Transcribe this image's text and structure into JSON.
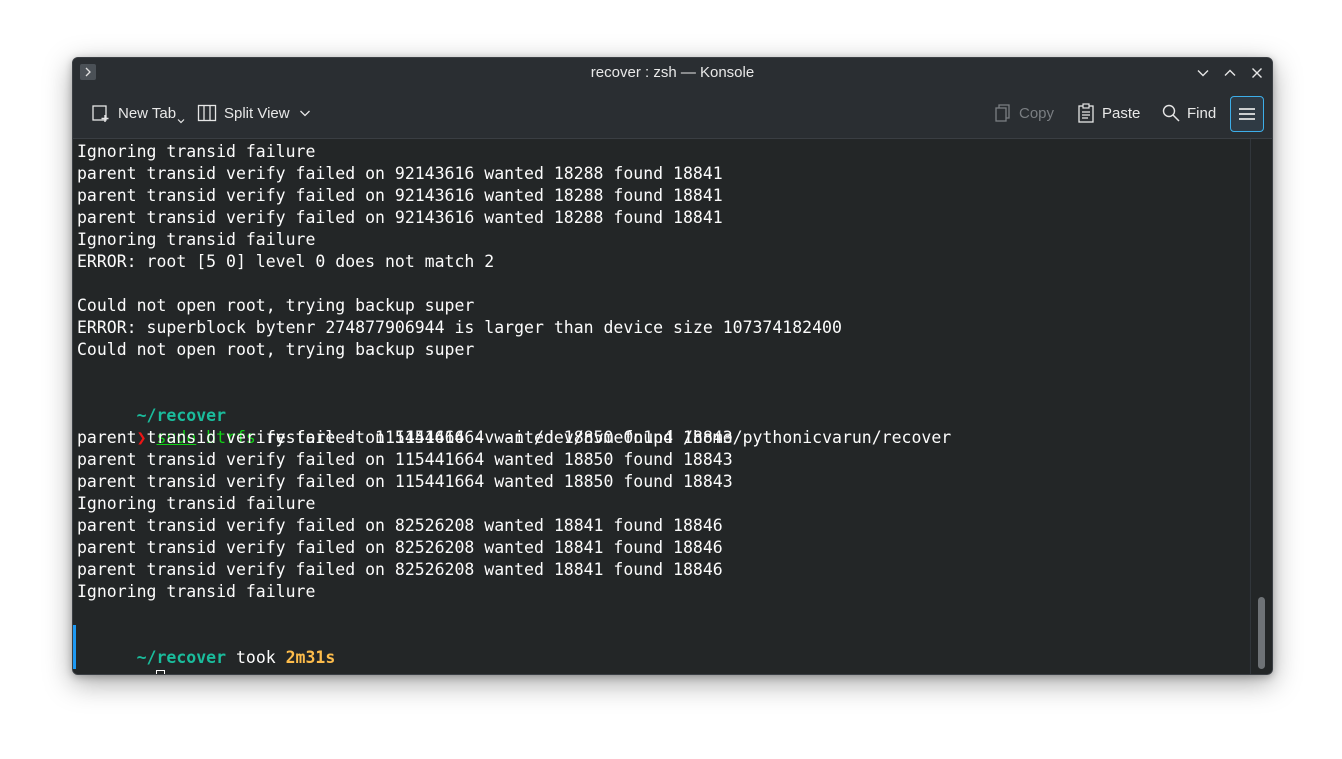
{
  "window": {
    "title": "recover : zsh — Konsole"
  },
  "toolbar": {
    "new_tab_label": "New Tab",
    "split_view_label": "Split View",
    "copy_label": "Copy",
    "paste_label": "Paste",
    "find_label": "Find"
  },
  "terminal": {
    "lines": [
      "Ignoring transid failure",
      "parent transid verify failed on 92143616 wanted 18288 found 18841",
      "parent transid verify failed on 92143616 wanted 18288 found 18841",
      "parent transid verify failed on 92143616 wanted 18288 found 18841",
      "Ignoring transid failure",
      "ERROR: root [5 0] level 0 does not match 2",
      "",
      "Could not open root, trying backup super",
      "ERROR: superblock bytenr 274877906944 is larger than device size 107374182400",
      "Could not open root, trying backup super"
    ],
    "prompt1_dir": "~/recover",
    "prompt1_arrow": "❯",
    "cmd_sudo": "sudo",
    "cmd_btrfs": "btrfs",
    "cmd_rest": " restore -t 115441664 -v -i /dev/nvme0n1p4 /home/pythonicvarun/recover",
    "output_lines": [
      "parent transid verify failed on 115441664 wanted 18850 found 18843",
      "parent transid verify failed on 115441664 wanted 18850 found 18843",
      "parent transid verify failed on 115441664 wanted 18850 found 18843",
      "Ignoring transid failure",
      "parent transid verify failed on 82526208 wanted 18841 found 18846",
      "parent transid verify failed on 82526208 wanted 18841 found 18846",
      "parent transid verify failed on 82526208 wanted 18841 found 18846",
      "Ignoring transid failure"
    ],
    "prompt2_dir": "~/recover",
    "prompt2_took": " took ",
    "prompt2_duration": "2m31s",
    "prompt2_arrow": "❯"
  },
  "colors": {
    "prompt_dir": "#1abc9c",
    "error_arrow": "#ed1515",
    "command": "#11d116",
    "duration": "#fdbc4b",
    "accent": "#3daee9"
  }
}
